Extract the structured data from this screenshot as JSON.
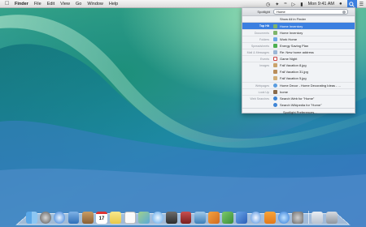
{
  "menubar": {
    "app_name": "Finder",
    "menus": [
      "File",
      "Edit",
      "View",
      "Go",
      "Window",
      "Help"
    ],
    "clock": "Mon 9:41 AM"
  },
  "spotlight": {
    "label": "Spotlight",
    "query": "Home",
    "show_all": "Show All in Finder",
    "top_hit": {
      "category": "Top Hit",
      "title": "Home Inventory"
    },
    "documents": {
      "category": "Documents",
      "items": [
        "Home Inventory"
      ]
    },
    "folders": {
      "category": "Folders",
      "items": [
        "Work Home"
      ]
    },
    "spreadsheets": {
      "category": "Spreadsheets",
      "items": [
        "Energy Saving Plan"
      ]
    },
    "mail": {
      "category": "Mail & Messages",
      "items": [
        "Re: New home address"
      ]
    },
    "events": {
      "category": "Events",
      "items": [
        "Game Night"
      ]
    },
    "images": {
      "category": "Images",
      "items": [
        "Fall Vacation 8.jpg",
        "Fall Vacation 31.jpg",
        "Fall Vacation 5.jpg"
      ]
    },
    "webpages": {
      "category": "Webpages",
      "items": [
        "Home Decor - Home Decorating Ideas - ..."
      ]
    },
    "lookup": {
      "category": "Look Up",
      "items": [
        "home"
      ]
    },
    "web_searches": {
      "category": "Web Searches",
      "items": [
        "Search Web for \"Home\"",
        "Search Wikipedia for \"Home\""
      ]
    },
    "preferences": "Spotlight Preferences..."
  },
  "dock": {
    "calendar_day": "17",
    "apps": [
      "finder-icon",
      "launchpad-icon",
      "safari-icon",
      "mail-icon",
      "contacts-icon",
      "calendar-icon",
      "notes-icon",
      "reminders-icon",
      "maps-icon",
      "messages-icon",
      "facetime-icon",
      "photo-booth-icon",
      "iphoto-icon",
      "pages-icon",
      "numbers-icon",
      "keynote-icon",
      "itunes-icon",
      "ibooks-icon",
      "app-store-icon",
      "system-preferences-icon",
      "downloads-icon",
      "trash-icon"
    ]
  },
  "colors": {
    "selection": "#3b7fe0",
    "wallpaper_top": "#3aa88a",
    "wallpaper_bottom": "#4b86c7"
  }
}
